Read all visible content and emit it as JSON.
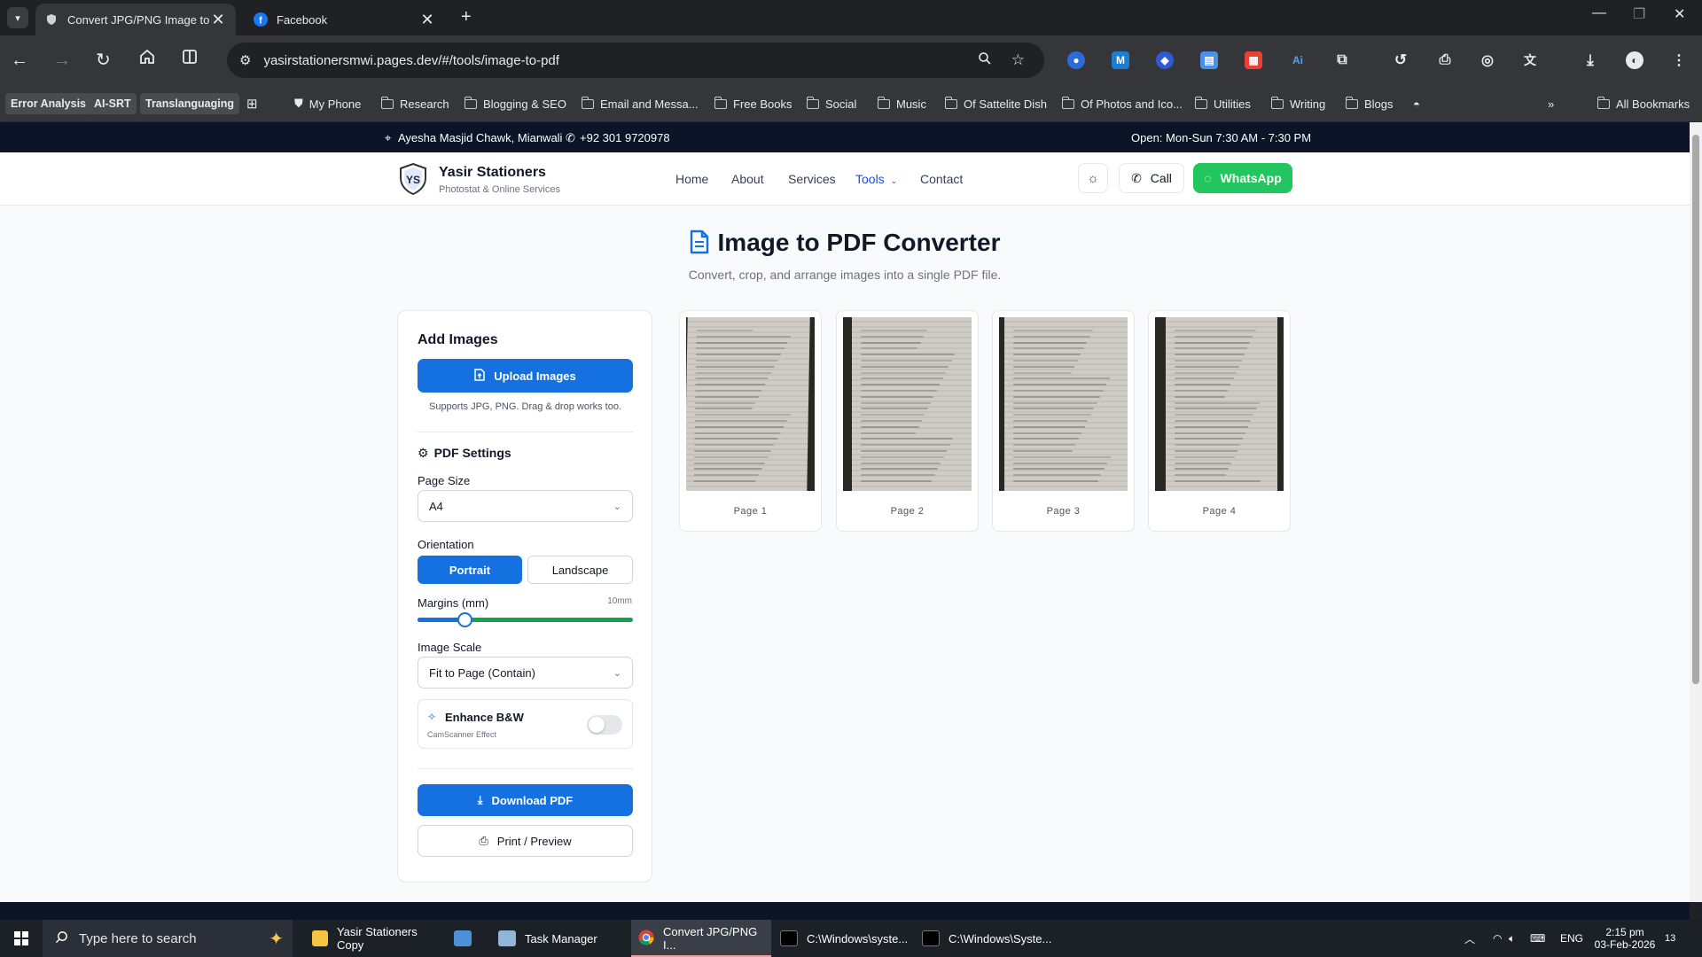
{
  "browser": {
    "tabs": [
      {
        "title": "Convert JPG/PNG Image to I",
        "active": true
      },
      {
        "title": "Facebook",
        "active": false
      }
    ],
    "url": "yasirstationersmwi.pages.dev/#/tools/image-to-pdf",
    "bookmarks": {
      "chips": [
        "Error Analysis",
        "AI-SRT",
        "Translanguaging"
      ],
      "my_phone": "My Phone",
      "folders": [
        "Research",
        "Blogging & SEO",
        "Email and Messa...",
        "Free Books",
        "Social",
        "Music",
        "Of Sattelite Dish",
        "Of Photos and Ico...",
        "Utilities",
        "Writing",
        "Blogs"
      ],
      "overflow": "»",
      "all_bookmarks": "All Bookmarks"
    }
  },
  "site": {
    "topbar": {
      "address": "Ayesha Masjid Chawk, Mianwali",
      "phone": "+92 301 9720978",
      "hours": "Open: Mon-Sun 7:30 AM - 7:30 PM"
    },
    "brand": {
      "name": "Yasir Stationers",
      "tagline": "Photostat & Online Services",
      "logo_text": "YS"
    },
    "nav": [
      "Home",
      "About",
      "Services",
      "Tools",
      "Contact"
    ],
    "active_nav": "Tools",
    "call_label": "Call",
    "whatsapp_label": "WhatsApp",
    "accent": "#1571e0",
    "whatsapp_color": "#22c55e"
  },
  "tool": {
    "title": "Image to PDF Converter",
    "subtitle": "Convert, crop, and arrange images into a single PDF file.",
    "add_images": {
      "heading": "Add Images",
      "upload_label": "Upload Images",
      "hint": "Supports JPG, PNG. Drag & drop works too."
    },
    "settings": {
      "heading": "PDF Settings",
      "page_size_label": "Page Size",
      "page_size_value": "A4",
      "orientation_label": "Orientation",
      "orientation_options": [
        "Portrait",
        "Landscape"
      ],
      "orientation_selected": "Portrait",
      "margins_label": "Margins (mm)",
      "margins_value_text": "10mm",
      "margins_fraction": 0.22,
      "image_scale_label": "Image Scale",
      "image_scale_value": "Fit to Page (Contain)",
      "enhance_label": "Enhance B&W",
      "enhance_sub": "CamScanner Effect",
      "enhance_on": false
    },
    "download_label": "Download PDF",
    "print_label": "Print / Preview",
    "pages": [
      "Page 1",
      "Page 2",
      "Page 3",
      "Page 4"
    ]
  },
  "taskbar": {
    "search_placeholder": "Type here to search",
    "items": [
      "Yasir Stationers Copy",
      "Task Manager",
      "Convert JPG/PNG I...",
      "C:\\Windows\\syste...",
      "C:\\Windows\\Syste..."
    ],
    "language": "ENG",
    "time": "2:15 pm",
    "date": "03-Feb-2026",
    "notifications": "13"
  }
}
